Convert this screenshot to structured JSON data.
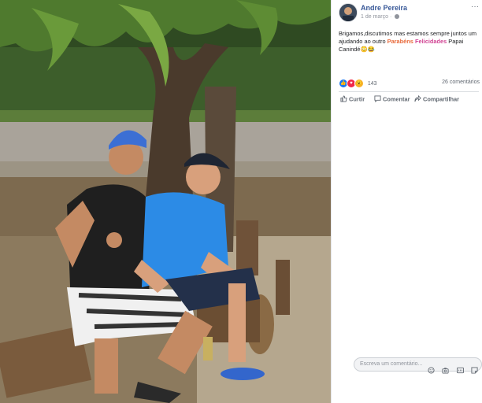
{
  "post": {
    "author": "Andre Pereira",
    "date": "1 de março",
    "more": "···",
    "text_part1": "Brigamos,discutimos mas estamos sempre juntos um ajudando ao outro ",
    "text_hl1": "Parabéns",
    "text_hl2": "Felicidades",
    "text_part2": " Papai Canindé",
    "text_emoji": "😳😂"
  },
  "reactions": {
    "count": "143",
    "types": [
      "like-icon",
      "love-icon",
      "wow-icon"
    ],
    "comments": "26 comentários"
  },
  "actions": {
    "like": "Curtir",
    "comment": "Comentar",
    "share": "Compartilhar"
  },
  "comment_input": {
    "placeholder": "Escreva um comentário..."
  },
  "colors": {
    "author": "#385898",
    "like_blue": "#1877f2",
    "highlight_orange": "#e8693a",
    "highlight_pink": "#d14594"
  }
}
